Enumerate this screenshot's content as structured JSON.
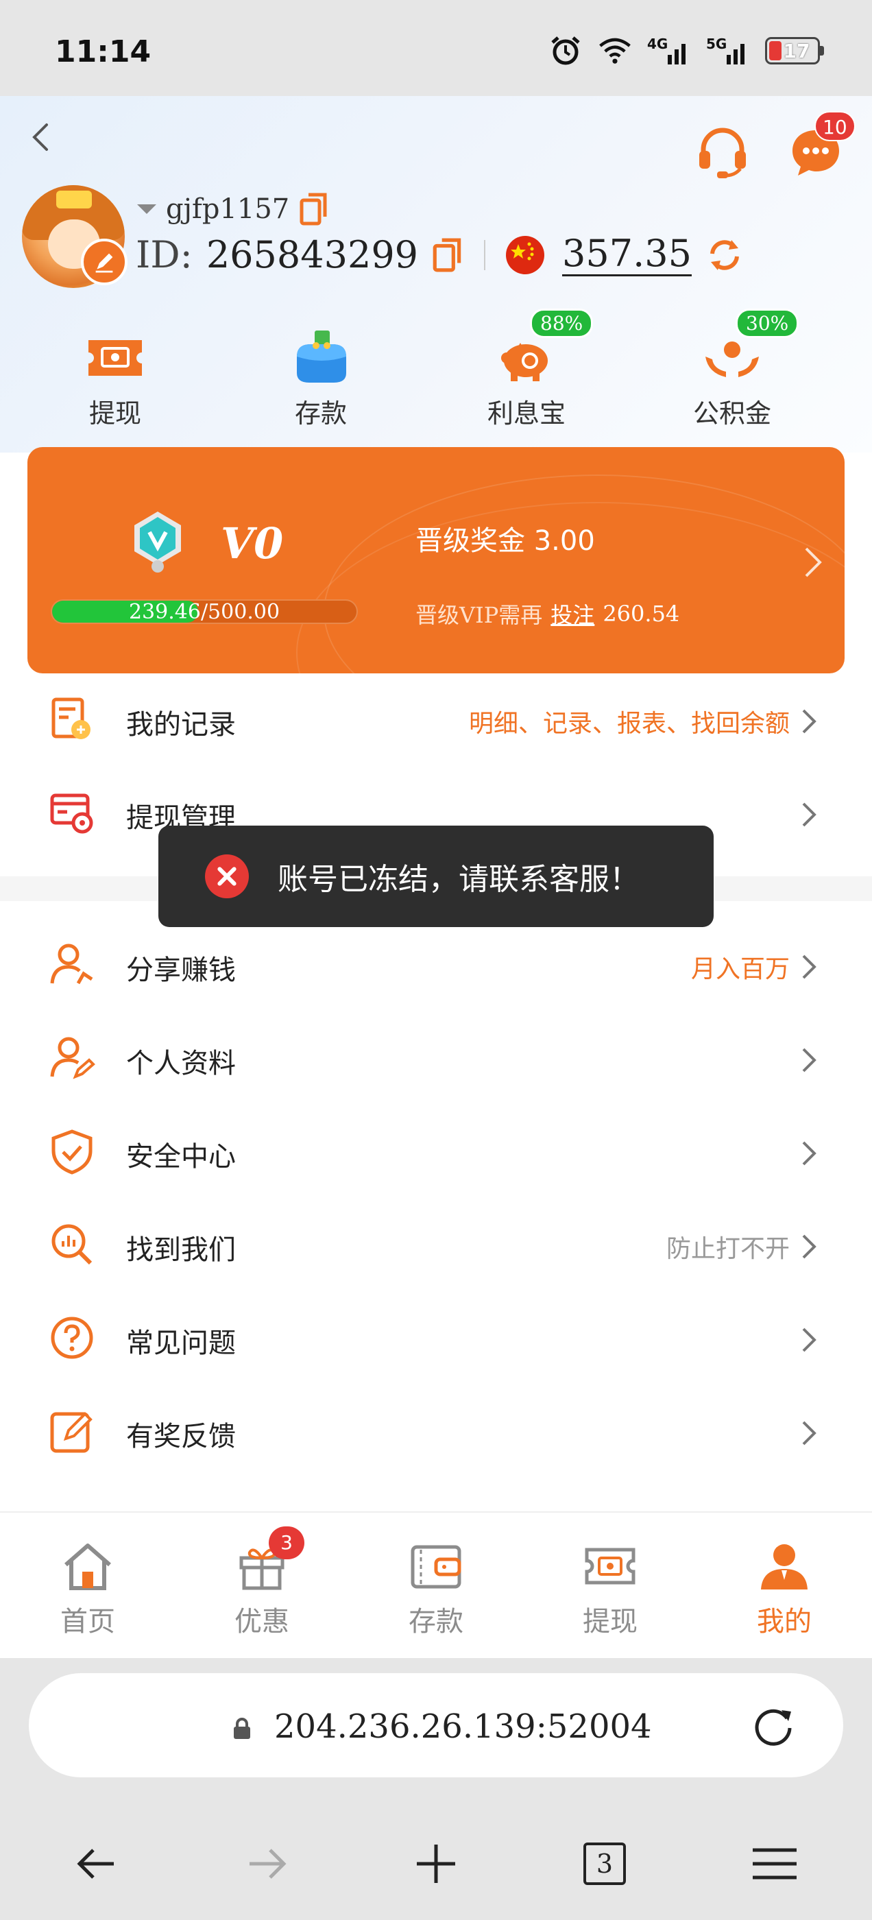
{
  "status_bar": {
    "time": "11:14",
    "net1": "4G",
    "net2": "5G",
    "battery": "17"
  },
  "header": {
    "username": "gjfp1157",
    "id_label": "ID:",
    "id_value": "265843299",
    "balance": "357.35",
    "message_badge": "10"
  },
  "quick_actions": [
    {
      "label": "提现",
      "icon": "withdraw-icon"
    },
    {
      "label": "存款",
      "icon": "wallet-icon"
    },
    {
      "label": "利息宝",
      "icon": "piggy-bank-icon",
      "badge": "88%"
    },
    {
      "label": "公积金",
      "icon": "hands-coin-icon",
      "badge": "30%"
    }
  ],
  "vip": {
    "level": "V0",
    "bonus_label": "晋级奖金 3.00",
    "progress_current": "239.46",
    "progress_total": "/500.00",
    "progress_fraction": 0.479,
    "need_label": "晋级VIP需再",
    "need_bet": "投注",
    "need_amount": "260.54"
  },
  "menu": [
    {
      "label": "我的记录",
      "hint": "明细、记录、报表、找回余额",
      "icon": "records-icon"
    },
    {
      "label": "提现管理",
      "hint": "",
      "icon": "withdraw-manage-icon"
    },
    {
      "label": "分享赚钱",
      "hint": "月入百万",
      "icon": "share-icon"
    },
    {
      "label": "个人资料",
      "hint": "",
      "icon": "profile-icon"
    },
    {
      "label": "安全中心",
      "hint": "",
      "icon": "shield-icon"
    },
    {
      "label": "找到我们",
      "hint": "防止打不开",
      "icon": "search-doc-icon"
    },
    {
      "label": "常见问题",
      "hint": "",
      "icon": "question-icon"
    },
    {
      "label": "有奖反馈",
      "hint": "",
      "icon": "edit-icon"
    }
  ],
  "toast": {
    "message": "账号已冻结，请联系客服！"
  },
  "tabs": [
    {
      "label": "首页",
      "icon": "home-icon"
    },
    {
      "label": "优惠",
      "icon": "gift-icon",
      "badge": "3"
    },
    {
      "label": "存款",
      "icon": "wallet-icon"
    },
    {
      "label": "提现",
      "icon": "withdraw-icon"
    },
    {
      "label": "我的",
      "icon": "user-icon",
      "active": true
    }
  ],
  "browser": {
    "url": "204.236.26.139:52004",
    "tab_count": "3"
  },
  "colors": {
    "accent": "#f07324",
    "success": "#22c53a",
    "danger": "#e53935"
  }
}
